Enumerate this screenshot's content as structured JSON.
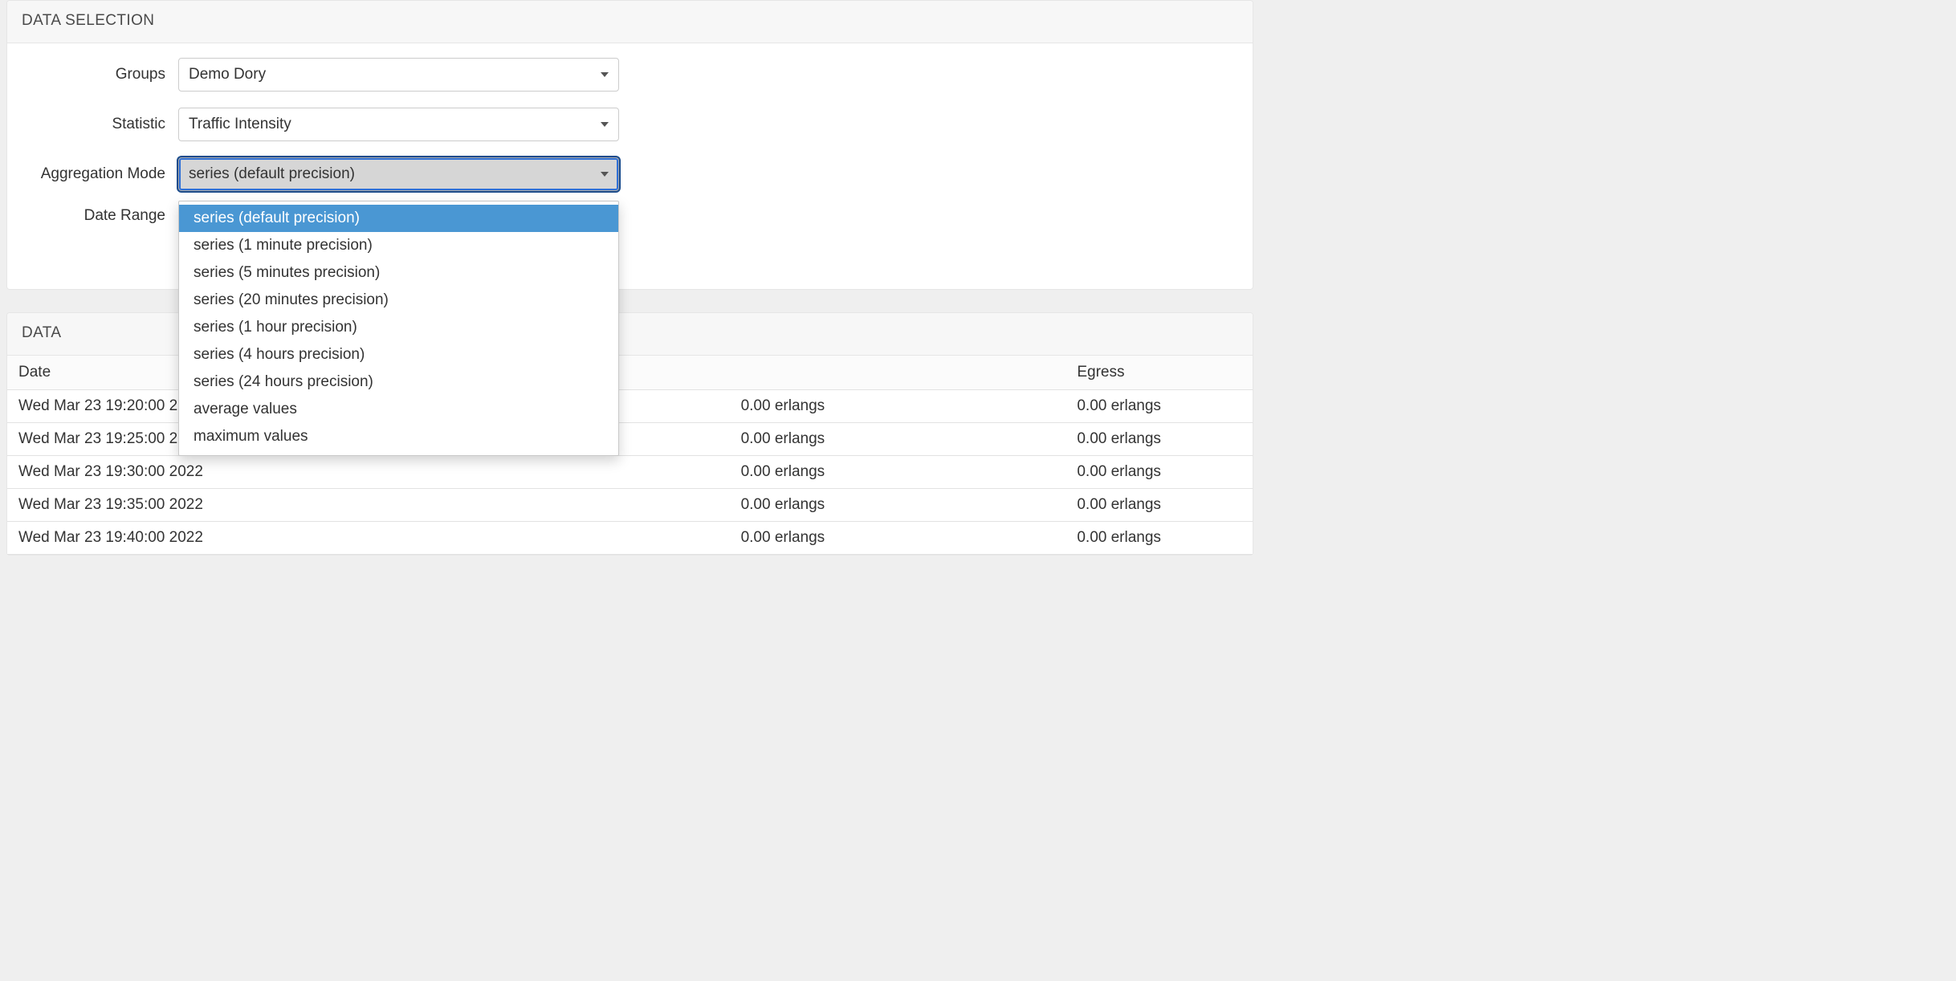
{
  "selection": {
    "title": "DATA SELECTION",
    "labels": {
      "groups": "Groups",
      "statistic": "Statistic",
      "aggregation": "Aggregation Mode",
      "date_range": "Date Range"
    },
    "groups": {
      "value": "Demo Dory"
    },
    "statistic": {
      "value": "Traffic Intensity"
    },
    "aggregation": {
      "value": "series (default precision)",
      "options": [
        "series (default precision)",
        "series (1 minute precision)",
        "series (5 minutes precision)",
        "series (20 minutes precision)",
        "series (1 hour precision)",
        "series (4 hours precision)",
        "series (24 hours precision)",
        "average values",
        "maximum values"
      ],
      "highlighted_index": 0,
      "open": true
    }
  },
  "data_panel": {
    "title": "DATA",
    "columns": [
      "Date",
      "",
      "Egress"
    ],
    "rows": [
      {
        "date": "Wed Mar 23 19:20:00 2022",
        "mid": "0.00 erlangs",
        "egress": "0.00 erlangs"
      },
      {
        "date": "Wed Mar 23 19:25:00 2022",
        "mid": "0.00 erlangs",
        "egress": "0.00 erlangs"
      },
      {
        "date": "Wed Mar 23 19:30:00 2022",
        "mid": "0.00 erlangs",
        "egress": "0.00 erlangs"
      },
      {
        "date": "Wed Mar 23 19:35:00 2022",
        "mid": "0.00 erlangs",
        "egress": "0.00 erlangs"
      },
      {
        "date": "Wed Mar 23 19:40:00 2022",
        "mid": "0.00 erlangs",
        "egress": "0.00 erlangs"
      }
    ]
  }
}
